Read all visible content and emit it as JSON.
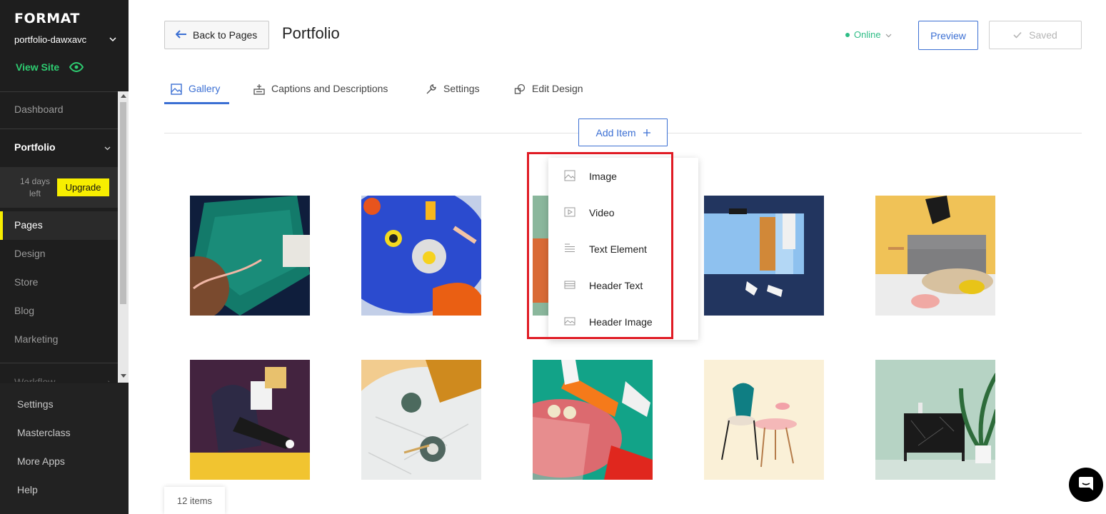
{
  "sidebar": {
    "brand": "FORMAT",
    "site_name": "portfolio-dawxavc",
    "view_site": "View Site",
    "dashboard": "Dashboard",
    "portfolio": "Portfolio",
    "trial": {
      "line1": "14 days",
      "line2": "left",
      "upgrade": "Upgrade"
    },
    "nav": [
      "Pages",
      "Design",
      "Store",
      "Blog",
      "Marketing"
    ],
    "workflow": "Workflow",
    "bottom": [
      "Settings",
      "Masterclass",
      "More Apps",
      "Help"
    ]
  },
  "header": {
    "back": "Back to Pages",
    "title": "Portfolio",
    "status": "Online",
    "preview": "Preview",
    "saved": "Saved"
  },
  "tabs": [
    {
      "label": "Gallery",
      "icon": "image-icon",
      "active": true
    },
    {
      "label": "Captions and Descriptions",
      "icon": "captions-icon",
      "active": false
    },
    {
      "label": "Settings",
      "icon": "wrench-icon",
      "active": false
    },
    {
      "label": "Edit Design",
      "icon": "design-icon",
      "active": false
    }
  ],
  "add_item": {
    "label": "Add Item",
    "icon": "plus-icon"
  },
  "dropdown": [
    {
      "label": "Image",
      "icon": "image-icon"
    },
    {
      "label": "Video",
      "icon": "video-icon"
    },
    {
      "label": "Text Element",
      "icon": "text-lines-icon"
    },
    {
      "label": "Header Text",
      "icon": "header-text-icon"
    },
    {
      "label": "Header Image",
      "icon": "header-image-icon"
    }
  ],
  "gallery": {
    "item_count": "12 items",
    "thumbnails": [
      "green-sofa-phone",
      "breakfast-table",
      "green-chair",
      "blue-cabinet",
      "jumping-sofa",
      "woman-reading-chair",
      "marble-table-cup",
      "orange-legs-table",
      "patterned-chairs",
      "black-marble-cabinet"
    ]
  },
  "colors": {
    "accent": "#3b6fd3",
    "upgrade": "#f7ee00",
    "online": "#2ebd86",
    "highlight": "#e01b24"
  }
}
